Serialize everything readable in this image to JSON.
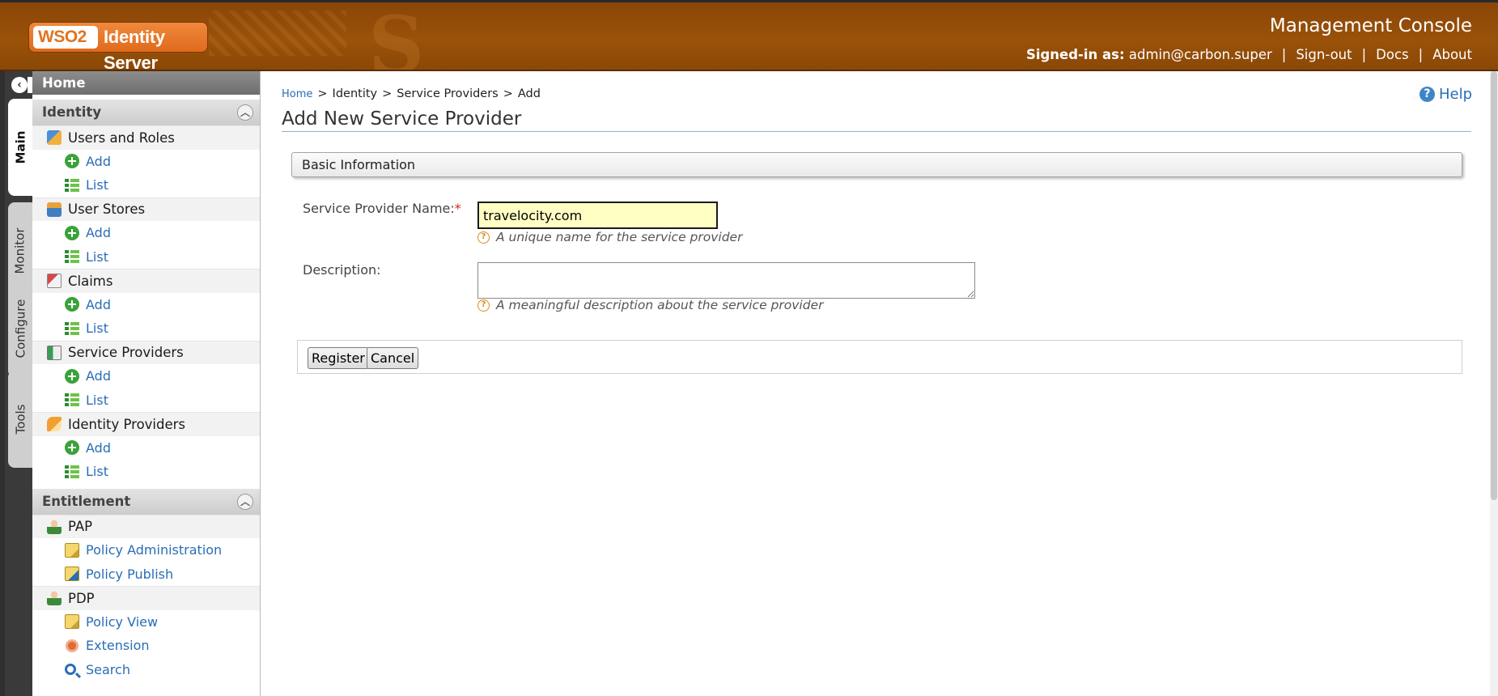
{
  "header": {
    "logo_wso": "WSO2",
    "logo_product": "Identity Server",
    "console_title": "Management Console",
    "signed_in_label": "Signed-in as:",
    "signed_in_user": "admin@carbon.super",
    "links": [
      "Sign-out",
      "Docs",
      "About"
    ],
    "separator": "|"
  },
  "tabs": [
    "Main",
    "Monitor",
    "Configure",
    "Tools"
  ],
  "sidebar": {
    "home": "Home",
    "sections": [
      {
        "title": "Identity",
        "groups": [
          {
            "label": "Users and Roles",
            "icon": "users-icon",
            "items": [
              {
                "label": "Add",
                "icon": "add-icon"
              },
              {
                "label": "List",
                "icon": "list-icon"
              }
            ]
          },
          {
            "label": "User Stores",
            "icon": "user-store-icon",
            "items": [
              {
                "label": "Add",
                "icon": "add-icon"
              },
              {
                "label": "List",
                "icon": "list-icon"
              }
            ]
          },
          {
            "label": "Claims",
            "icon": "claims-icon",
            "items": [
              {
                "label": "Add",
                "icon": "add-icon"
              },
              {
                "label": "List",
                "icon": "list-icon"
              }
            ]
          },
          {
            "label": "Service Providers",
            "icon": "service-provider-icon",
            "items": [
              {
                "label": "Add",
                "icon": "add-icon"
              },
              {
                "label": "List",
                "icon": "list-icon"
              }
            ]
          },
          {
            "label": "Identity Providers",
            "icon": "identity-provider-icon",
            "items": [
              {
                "label": "Add",
                "icon": "add-icon"
              },
              {
                "label": "List",
                "icon": "list-icon"
              }
            ]
          }
        ]
      },
      {
        "title": "Entitlement",
        "groups": [
          {
            "label": "PAP",
            "icon": "pap-icon",
            "items": [
              {
                "label": "Policy Administration",
                "icon": "policy-doc-icon"
              },
              {
                "label": "Policy Publish",
                "icon": "policy-publish-icon"
              }
            ]
          },
          {
            "label": "PDP",
            "icon": "pdp-icon",
            "items": [
              {
                "label": "Policy View",
                "icon": "policy-doc-icon"
              },
              {
                "label": "Extension",
                "icon": "extension-icon"
              },
              {
                "label": "Search",
                "icon": "search-icon"
              }
            ]
          }
        ]
      }
    ]
  },
  "main": {
    "breadcrumb": [
      "Home",
      "Identity",
      "Service Providers",
      "Add"
    ],
    "breadcrumb_sep": ">",
    "help": "Help",
    "title": "Add New Service Provider",
    "section_title": "Basic Information",
    "fields": {
      "name_label": "Service Provider Name:",
      "required_mark": "*",
      "name_value": "travelocity.com",
      "name_hint": "A unique name for the service provider",
      "description_label": "Description:",
      "description_value": "",
      "description_hint": "A meaningful description about the service provider"
    },
    "buttons": {
      "register": "Register",
      "cancel": "Cancel"
    }
  },
  "colors": {
    "header_brown": "#9a5209",
    "accent_orange": "#e06a1c",
    "link_blue": "#2a6db5",
    "input_highlight": "#ffffc4"
  }
}
